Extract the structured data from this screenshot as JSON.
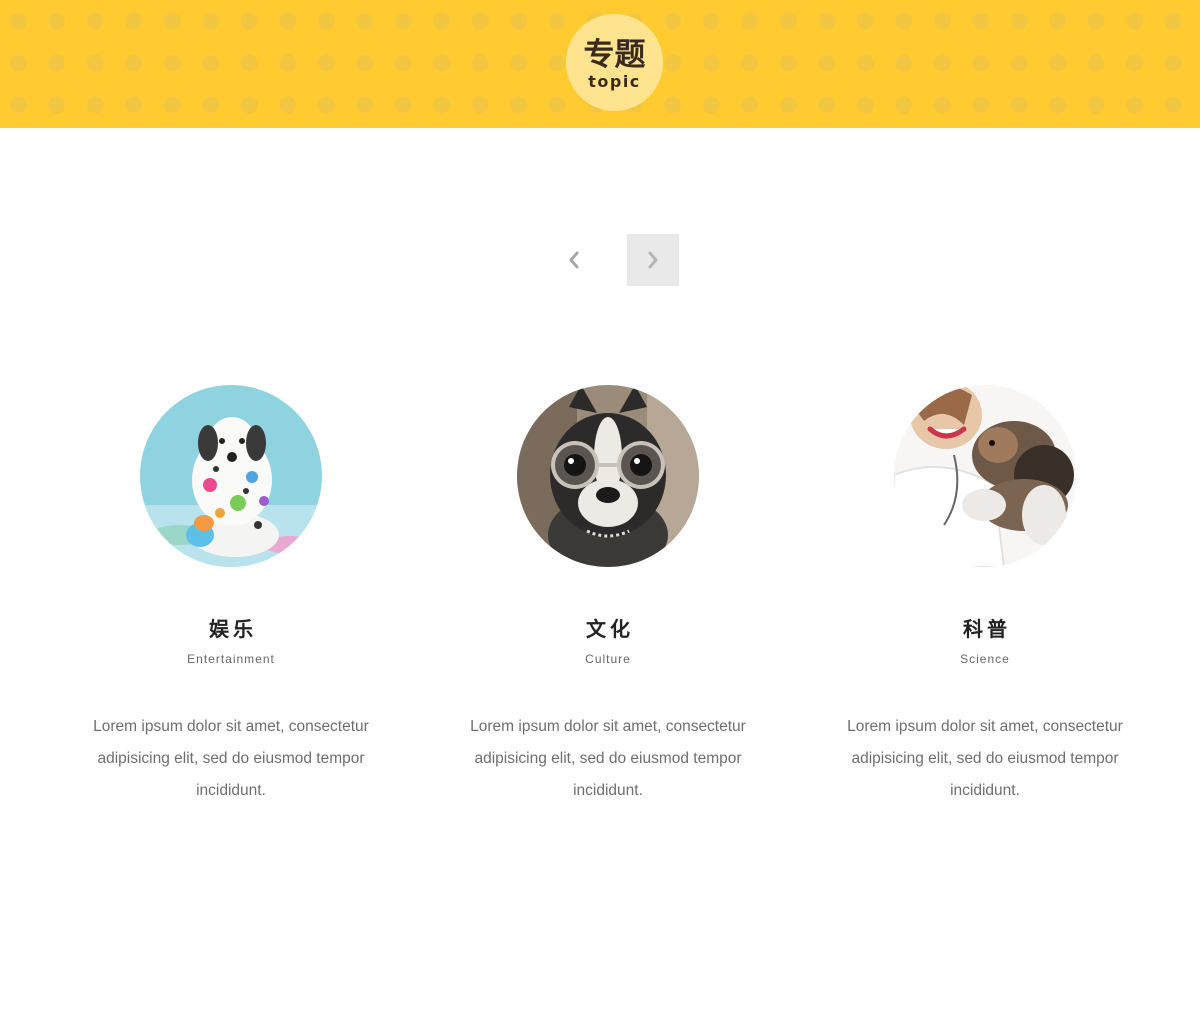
{
  "banner": {
    "badge_cn": "专题",
    "badge_en": "topic",
    "background_color": "#FFCB30",
    "badge_color": "#FFE48F"
  },
  "carousel": {
    "prev_icon": "chevron-left-icon",
    "next_icon": "chevron-right-icon"
  },
  "topics": [
    {
      "title_cn": "娱乐",
      "title_en": "Entertainment",
      "description": "Lorem ipsum dolor sit amet, consectetur adipisicing elit, sed do eiusmod tempor incididunt.",
      "image": "dalmatian-puppy-paint-photo"
    },
    {
      "title_cn": "文化",
      "title_en": "Culture",
      "description": "Lorem ipsum dolor sit amet, consectetur adipisicing elit, sed do eiusmod tempor incididunt.",
      "image": "dog-with-glasses-photo"
    },
    {
      "title_cn": "科普",
      "title_en": "Science",
      "description": "Lorem ipsum dolor sit amet, consectetur adipisicing elit, sed do eiusmod tempor incididunt.",
      "image": "vet-holding-puppy-photo"
    }
  ]
}
